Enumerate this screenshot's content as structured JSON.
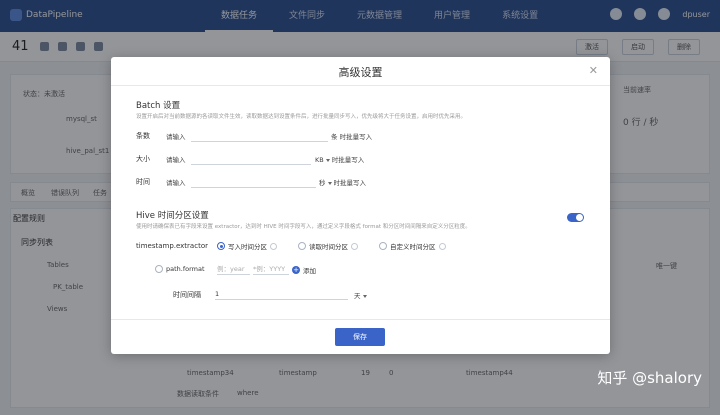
{
  "app": {
    "name": "DataPipeline"
  },
  "nav": {
    "items": [
      {
        "label": "数据任务",
        "active": true
      },
      {
        "label": "文件同步",
        "active": false
      },
      {
        "label": "元数据管理",
        "active": false
      },
      {
        "label": "用户管理",
        "active": false
      },
      {
        "label": "系统设置",
        "active": false
      }
    ]
  },
  "user": {
    "name": "dpuser"
  },
  "toolbar": {
    "task_id": "41",
    "right_buttons": [
      "激活",
      "启动",
      "删除"
    ]
  },
  "background": {
    "status_label": "状态：未激活",
    "source_name": "mysql_st",
    "dest_name": "hive_pal_st1",
    "rate": "0 行 / 秒",
    "rate_label": "当前速率",
    "tabs": [
      "概览",
      "错误队列",
      "任务"
    ],
    "rules_title": "配置规则",
    "sync_list": "同步列表",
    "tables_label": "Tables",
    "table_item": "PK_table",
    "views_label": "Views",
    "bottom_cells": [
      "timestamp34",
      "timestamp",
      "19",
      "0",
      "timestamp44"
    ],
    "bottom_label": "数据读取条件",
    "bottom_value": "where",
    "only_label": "唯一键"
  },
  "modal": {
    "title": "高级设置",
    "batch": {
      "title": "Batch 设置",
      "desc": "设置开启后对当前数据源的各读取文件生效，读取数据达到设置条件后，进行批量同步写入，优先级将大于任务设置，启用时优先采用。",
      "rows": [
        {
          "label": "条数",
          "placeholder": "请输入",
          "unit": "条 时批量写入",
          "has_dropdown": false
        },
        {
          "label": "大小",
          "placeholder": "请输入",
          "unit": "KB",
          "suffix": "时批量写入",
          "has_dropdown": true
        },
        {
          "label": "时间",
          "placeholder": "请输入",
          "unit": "秒",
          "suffix": "时批量写入",
          "has_dropdown": true
        }
      ]
    },
    "hive": {
      "title": "Hive 时间分区设置",
      "desc": "使用时请确保表已有字段来设置 extractor，达到时 HIVE 时间字段写入，通过定义字段格式 format 和分区时间间隔来自定义分区粒度。",
      "enabled": true,
      "extractor_label": "timestamp.extractor",
      "options": [
        {
          "label": "写入时间分区",
          "checked": true
        },
        {
          "label": "读取时间分区",
          "checked": false
        },
        {
          "label": "自定义时间分区",
          "checked": false
        }
      ],
      "path_format_label": "path.format",
      "path_format_placeholder1": "例：year",
      "path_format_placeholder2": "*例：YYYY",
      "add_label": "添加",
      "interval_label": "时间间隔",
      "interval_value": "1",
      "interval_unit": "天"
    },
    "save_label": "保存"
  },
  "watermark": "知乎 @shalory",
  "colors": {
    "primary": "#3a64c8",
    "topbar": "#2c4f8f"
  }
}
